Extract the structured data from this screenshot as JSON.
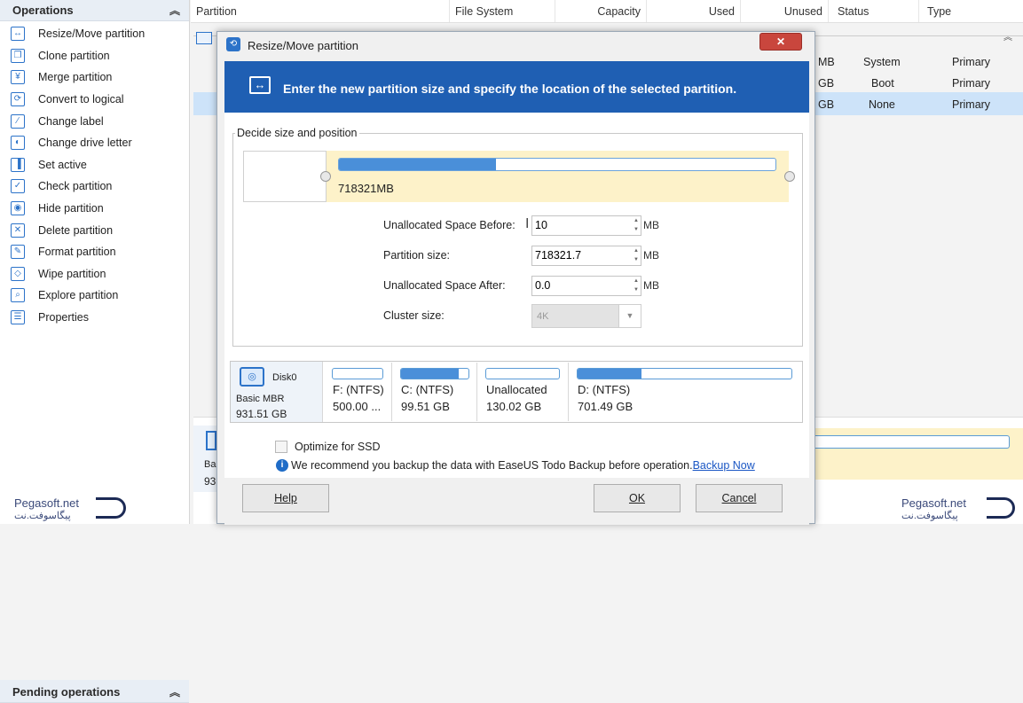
{
  "left_panel": {
    "operations_title": "Operations",
    "pending_title": "Pending operations",
    "operations": [
      {
        "label": "Resize/Move partition",
        "icon": "↔"
      },
      {
        "label": "Clone partition",
        "icon": "❐"
      },
      {
        "label": "Merge partition",
        "icon": "¥"
      },
      {
        "label": "Convert to logical",
        "icon": "⟳"
      },
      {
        "label": "Change label",
        "icon": "∕"
      },
      {
        "label": "Change drive letter",
        "icon": "◐"
      },
      {
        "label": "Set active",
        "icon": "▐"
      },
      {
        "label": "Check partition",
        "icon": "✓"
      },
      {
        "label": "Hide partition",
        "icon": "◉"
      },
      {
        "label": "Delete partition",
        "icon": "✕"
      },
      {
        "label": "Format partition",
        "icon": "✎"
      },
      {
        "label": "Wipe partition",
        "icon": "◇"
      },
      {
        "label": "Explore partition",
        "icon": "⌕"
      },
      {
        "label": "Properties",
        "icon": "☰"
      }
    ]
  },
  "grid": {
    "columns": [
      "Partition",
      "File System",
      "Capacity",
      "Used",
      "Unused",
      "Status",
      "Type"
    ],
    "rows": [
      {
        "unused_tail": "MB",
        "status": "System",
        "type": "Primary"
      },
      {
        "unused_tail": "GB",
        "status": "Boot",
        "type": "Primary"
      },
      {
        "unused_tail": "GB",
        "status": "None",
        "type": "Primary"
      }
    ],
    "bottom_disk_label_1": "Ba",
    "bottom_disk_label_2": "93"
  },
  "dialog": {
    "title": "Resize/Move partition",
    "close_label": "✕",
    "banner_text": "Enter the new partition size and specify the location of the selected partition.",
    "group_title": "Decide size and position",
    "slider_size_label": "718321MB",
    "slider_fill_fraction": 0.36,
    "fields": {
      "before_label": "Unallocated Space Before:",
      "before_value": "10",
      "before_unit": "MB",
      "size_label": "Partition size:",
      "size_value": "718321.7",
      "size_unit": "MB",
      "after_label": "Unallocated Space After:",
      "after_value": "0.0",
      "after_unit": "MB",
      "cluster_label": "Cluster size:",
      "cluster_value": "4K"
    },
    "disk": {
      "name": "Disk0",
      "type": "Basic MBR",
      "size": "931.51 GB",
      "partitions": [
        {
          "name": "F: (NTFS)",
          "size": "500.00 ...",
          "fill": 0.0
        },
        {
          "name": "C: (NTFS)",
          "size": "99.51 GB",
          "fill": 0.85
        },
        {
          "name": "Unallocated",
          "size": "130.02 GB",
          "fill": 0.0
        },
        {
          "name": "D: (NTFS)",
          "size": "701.49 GB",
          "fill": 0.3
        }
      ]
    },
    "optimize_label": "Optimize for SSD",
    "recommend_text": "We recommend you backup the data with EaseUS Todo Backup before operation.",
    "backup_link": "Backup Now",
    "help_label": "Help",
    "ok_label": "OK",
    "cancel_label": "Cancel"
  },
  "watermark": {
    "line1": "Pegasoft.net",
    "line2": "پیگاسوفت.نت"
  },
  "colors": {
    "accent": "#1f5fb3",
    "selection": "#cde3f9",
    "slider_bg": "#fdf2c9"
  }
}
